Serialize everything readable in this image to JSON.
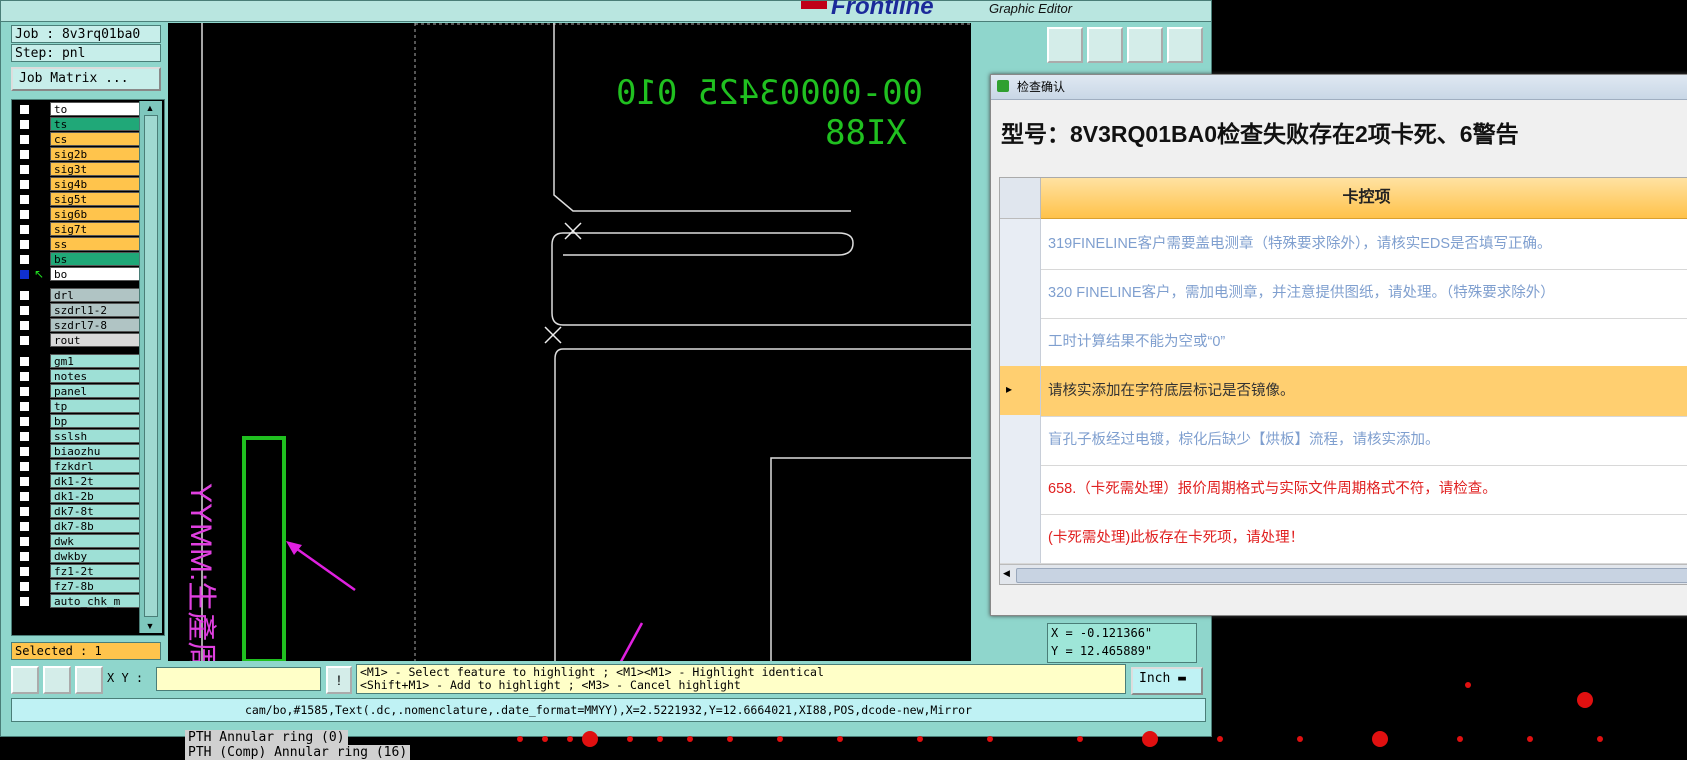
{
  "editor": {
    "caption": "Graphic Editor",
    "brand": "Frontline",
    "job_label": "Job : 8v3rq01ba0",
    "step_label": "Step: pnl",
    "job_matrix_button": "Job Matrix ...",
    "selected_label": "Selected : 1",
    "xy_label": "X Y :",
    "xy_input_value": "",
    "units_button": "Inch",
    "coord_x": "X = -0.121366\"",
    "coord_y": "Y = 12.465889\"",
    "help_line1": "<M1> - Select feature to highlight ; <M1><M1> - Highlight identical",
    "help_line2": "<Shift+M1> - Add to highlight ; <M3> - Cancel highlight",
    "status": "cam/bo,#1585,Text(.dc,.nomenclature,.date_format=MMYY),X=2.5221932,Y=12.6664021,XI88,POS,dcode-new,Mirror",
    "bottom_text_1": "PTH Annular ring (0)",
    "bottom_text_2": "PTH (Comp) Annular ring (16)"
  },
  "layers": [
    {
      "name": "to",
      "color": "#ffffff"
    },
    {
      "name": "ts",
      "color": "#20a878"
    },
    {
      "name": "cs",
      "color": "#ffc44c"
    },
    {
      "name": "sig2b",
      "color": "#ffc44c"
    },
    {
      "name": "sig3t",
      "color": "#ffc44c"
    },
    {
      "name": "sig4b",
      "color": "#ffc44c"
    },
    {
      "name": "sig5t",
      "color": "#ffc44c"
    },
    {
      "name": "sig6b",
      "color": "#ffc44c"
    },
    {
      "name": "sig7t",
      "color": "#ffc44c"
    },
    {
      "name": "ss",
      "color": "#ffc44c"
    },
    {
      "name": "bs",
      "color": "#20a878"
    },
    {
      "name": "bo",
      "color": "#ffffff",
      "active": true
    },
    {
      "name": "drl",
      "color": "#b0c4c4"
    },
    {
      "name": "szdrl1-2",
      "color": "#b0c4c4"
    },
    {
      "name": "szdrl7-8",
      "color": "#b0c4c4"
    },
    {
      "name": "rout",
      "color": "#d8d8d8"
    },
    {
      "name": "gm1",
      "color": "#9ee0d6"
    },
    {
      "name": "notes",
      "color": "#9ee0d6"
    },
    {
      "name": "panel",
      "color": "#9ee0d6"
    },
    {
      "name": "tp",
      "color": "#9ee0d6"
    },
    {
      "name": "bp",
      "color": "#9ee0d6"
    },
    {
      "name": "sslsh",
      "color": "#9ee0d6"
    },
    {
      "name": "biaozhu",
      "color": "#9ee0d6"
    },
    {
      "name": "fzkdrl",
      "color": "#9ee0d6"
    },
    {
      "name": "dk1-2t",
      "color": "#9ee0d6"
    },
    {
      "name": "dk1-2b",
      "color": "#9ee0d6"
    },
    {
      "name": "dk7-8t",
      "color": "#9ee0d6"
    },
    {
      "name": "dk7-8b",
      "color": "#9ee0d6"
    },
    {
      "name": "dwk",
      "color": "#9ee0d6"
    },
    {
      "name": "dwkby",
      "color": "#9ee0d6"
    },
    {
      "name": "fz1-2t",
      "color": "#9ee0d6"
    },
    {
      "name": "fz7-8b",
      "color": "#9ee0d6"
    },
    {
      "name": "auto_chk_m",
      "color": "#9ee0d6"
    }
  ],
  "canvas": {
    "text_top_1": "00-0000З425 010",
    "text_top_2": "XI88",
    "vertical_text": "YYMM:生產周期"
  },
  "dialog": {
    "title": "检查确认",
    "heading": "型号：8V3RQ01BA0检查失败存在2项卡死、6警告",
    "column_header": "卡控项",
    "rows": [
      {
        "text": "319FINELINE客户需要盖电测章（特殊要求除外），请核实EDS是否填写正确。",
        "color": "#7f9fcf"
      },
      {
        "text": "320 FINELINE客户，需加电测章，并注意提供图纸，请处理。（特殊要求除外）",
        "color": "#7f9fcf"
      },
      {
        "text": "工时计算结果不能为空或“0”",
        "color": "#7f9fcf"
      },
      {
        "text": "请核实添加在字符底层标记是否镜像。",
        "color": "#333333",
        "selected": true
      },
      {
        "text": "盲孔子板经过电镀，棕化后缺少【烘板】流程，请核实添加。",
        "color": "#7f9fcf"
      },
      {
        "text": "658.（卡死需处理）报价周期格式与实际文件周期格式不符，请检查。",
        "color": "#e02020"
      },
      {
        "text": "(卡死需处理)此板存在卡死项，请处理！",
        "color": "#e02020"
      }
    ]
  },
  "colors": {
    "accent_header": "#ffc24a",
    "selected_row": "#ffcf70",
    "annotation_arrow": "#e020e0",
    "canvas_text": "#20c020"
  }
}
